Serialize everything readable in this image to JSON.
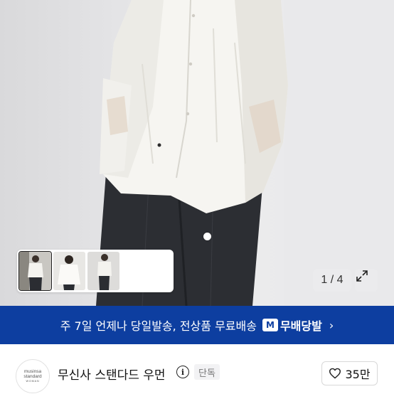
{
  "gallery": {
    "current": 1,
    "total": 4,
    "counter_text": "1 / 4",
    "thumbnail_count": 3
  },
  "banner": {
    "text": "주 7일 언제나 당일발송, 전상품 무료배송",
    "badge_letter": "M",
    "badge_label": "무배당발",
    "chevron": "›",
    "background": "#0d3ea0"
  },
  "brand": {
    "logo_line1": "musinsa",
    "logo_line2": "standard",
    "logo_line3": "WOMAN",
    "name": "무신사 스탠다드 우먼",
    "info_glyph": "i",
    "tag": "단독",
    "likes": "35만"
  },
  "icons": [
    "expand-icon",
    "info-icon",
    "heart-icon",
    "delivery-badge-icon",
    "chevron-right-icon"
  ]
}
